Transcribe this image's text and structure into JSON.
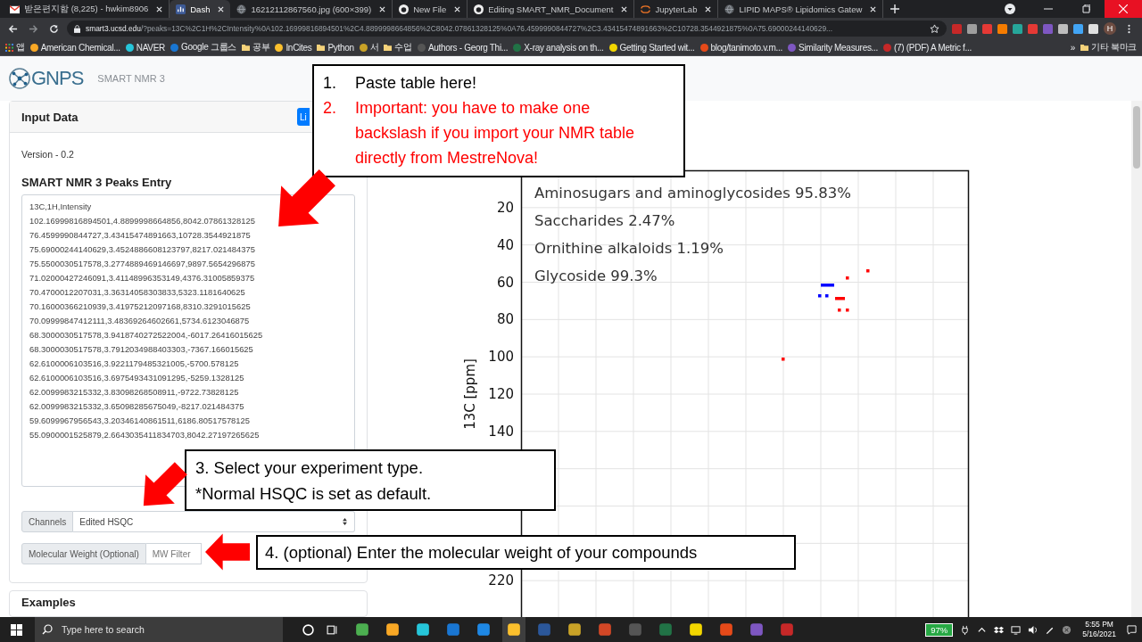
{
  "browser": {
    "tabs": [
      {
        "title": "받은편지함 (8,225) - hwkim8906",
        "kind": "mail",
        "selected": false
      },
      {
        "title": "Dash",
        "kind": "dash",
        "selected": true
      },
      {
        "title": "16212112867560.jpg (600×399)",
        "kind": "globe",
        "selected": false
      },
      {
        "title": "New File",
        "kind": "github",
        "selected": false
      },
      {
        "title": "Editing SMART_NMR_Document",
        "kind": "github",
        "selected": false
      },
      {
        "title": "JupyterLab",
        "kind": "jupyter",
        "selected": false
      },
      {
        "title": "LIPID MAPS® Lipidomics Gatew",
        "kind": "globe",
        "selected": false
      }
    ],
    "address": {
      "host": "smart3.ucsd.edu",
      "path": "/?peaks=13C%2C1H%2CIntensity%0A102.16999816894501%2C4.8899998664856%2C8042.07861328125%0A76.4599990844727%2C3.43415474891663%2C10728.3544921875%0A75.69000244140629..."
    },
    "profile_initial": "H",
    "bookmarks": [
      {
        "label": "앱",
        "kind": "apps"
      },
      {
        "label": "American Chemical...",
        "kind": "site"
      },
      {
        "label": "NAVER",
        "kind": "site"
      },
      {
        "label": "Google 그룹스",
        "kind": "site"
      },
      {
        "label": "공부",
        "kind": "folder"
      },
      {
        "label": "InCites",
        "kind": "site"
      },
      {
        "label": "Python",
        "kind": "folder"
      },
      {
        "label": "서",
        "kind": "site"
      },
      {
        "label": "수업",
        "kind": "folder"
      },
      {
        "label": "Authors - Georg Thi...",
        "kind": "site"
      },
      {
        "label": "X-ray analysis on th...",
        "kind": "site"
      },
      {
        "label": "Getting Started wit...",
        "kind": "site"
      },
      {
        "label": "blog/tanimoto.v.m...",
        "kind": "site"
      },
      {
        "label": "Similarity Measures...",
        "kind": "site"
      },
      {
        "label": "(7) (PDF) A Metric f...",
        "kind": "site"
      }
    ],
    "more_bookmarks": "»",
    "other_bookmarks": "기타 북마크"
  },
  "header": {
    "logo": "GNPS",
    "subtitle": "SMART NMR 3"
  },
  "input_card": {
    "title": "Input Data",
    "button": "Li",
    "version": "Version - 0.2",
    "peaks_label": "SMART NMR 3 Peaks Entry",
    "peaks_value": "13C,1H,Intensity\n102.16999816894501,4.8899998664856,8042.07861328125\n76.4599990844727,3.43415474891663,10728.3544921875\n75.69000244140629,3.4524886608123797,8217.021484375\n75.5500030517578,3.2774889469146697,9897.5654296875\n71.02000427246091,3.41148996353149,4376.31005859375\n70.4700012207031,3.36314058303833,5323.1181640625\n70.16000366210939,3.41975212097168,8310.3291015625\n70.09999847412111,3.48369264602661,5734.6123046875\n68.3000030517578,3.9418740272522004,-6017.26416015625\n68.3000030517578,3.7912034988403303,-7367.166015625\n62.6100006103516,3.9221179485321005,-5700.578125\n62.6100006103516,3.6975493431091295,-5259.1328125\n62.0099983215332,3.83098268508911,-9722.73828125\n62.0099983215332,3.65098285675049,-8217.021484375\n59.6099967956543,3.20346140861511,6186.80517578125\n55.0900001525879,2.6643035411834703,8042.27197265625",
    "channels": {
      "label": "Channels",
      "value": "Edited HSQC"
    },
    "molecular_weight": {
      "label": "Molecular Weight (Optional)",
      "placeholder": "MW Filter"
    }
  },
  "examples_card": {
    "title": "Examples"
  },
  "plot": {
    "ylabel": "13C [ppm]",
    "y_tick_labels": [
      "20",
      "40",
      "60",
      "80",
      "100",
      "120",
      "140",
      "220"
    ],
    "annotations": [
      "Aminosugars and aminoglycosides 95.83%",
      "Saccharides 2.47%",
      "Ornithine alkaloids 1.19%",
      "Glycoside 99.3%"
    ]
  },
  "callouts": [
    {
      "items": [
        {
          "number": "1.",
          "text": "Paste table here!",
          "important": false
        },
        {
          "number": "2.",
          "text": "Important: you have to make one backslash if you import your NMR table directly from MestreNova!",
          "important": true
        }
      ]
    },
    {
      "items": [
        {
          "text": "3. Select your experiment type.",
          "important": false
        },
        {
          "text": "*Normal HSQC is set as default.",
          "important": false
        }
      ]
    },
    {
      "items": [
        {
          "text": "4. (optional) Enter the molecular weight of your compounds",
          "important": false
        }
      ]
    }
  ],
  "taskbar": {
    "search_placeholder": "Type here to search",
    "battery": "97%",
    "time": "5:55 PM",
    "date": "5/16/2021"
  }
}
